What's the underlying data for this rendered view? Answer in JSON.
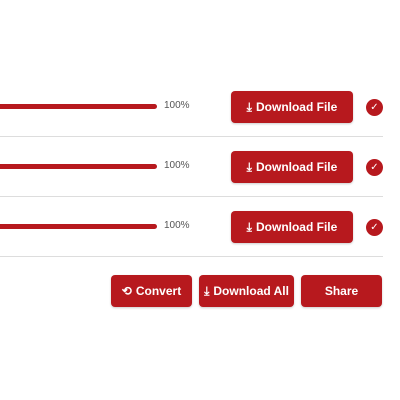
{
  "files": [
    {
      "progress": 100,
      "percent_label": "100%",
      "button_label": "Download File"
    },
    {
      "progress": 100,
      "percent_label": "100%",
      "button_label": "Download File"
    },
    {
      "progress": 100,
      "percent_label": "100%",
      "button_label": "Download File"
    }
  ],
  "actions": {
    "convert": "Convert",
    "download_all": "Download All",
    "share": "Share"
  },
  "accent": "#b7191e"
}
